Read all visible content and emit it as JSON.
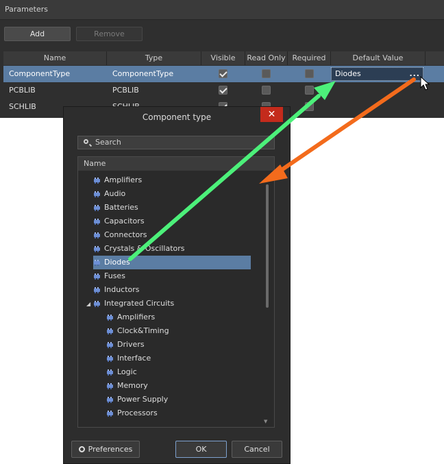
{
  "panel": {
    "title": "Parameters",
    "add_label": "Add",
    "remove_label": "Remove",
    "columns": [
      "Name",
      "Type",
      "Visible",
      "Read Only",
      "Required",
      "Default Value"
    ],
    "rows": [
      {
        "name": "ComponentType",
        "type": "ComponentType",
        "visible": true,
        "read_only": false,
        "required": false,
        "default_value": "Diodes",
        "selected": true
      },
      {
        "name": "PCBLIB",
        "type": "PCBLIB",
        "visible": true,
        "read_only": false,
        "required": false,
        "default_value": "",
        "selected": false
      },
      {
        "name": "SCHLIB",
        "type": "SCHLIB",
        "visible": true,
        "read_only": false,
        "required": false,
        "default_value": "",
        "selected": false
      }
    ],
    "browse_label": "..."
  },
  "dialog": {
    "title": "Component type",
    "close_glyph": "✕",
    "search_placeholder": "Search",
    "tree_header": "Name",
    "items": [
      {
        "label": "Amplifiers",
        "level": 0
      },
      {
        "label": "Audio",
        "level": 0
      },
      {
        "label": "Batteries",
        "level": 0
      },
      {
        "label": "Capacitors",
        "level": 0
      },
      {
        "label": "Connectors",
        "level": 0
      },
      {
        "label": "Crystals & Oscillators",
        "level": 0
      },
      {
        "label": "Diodes",
        "level": 0,
        "selected": true
      },
      {
        "label": "Fuses",
        "level": 0
      },
      {
        "label": "Inductors",
        "level": 0
      },
      {
        "label": "Integrated Circuits",
        "level": 0,
        "expanded": true
      },
      {
        "label": "Amplifiers",
        "level": 1
      },
      {
        "label": "Clock&Timing",
        "level": 1
      },
      {
        "label": "Drivers",
        "level": 1
      },
      {
        "label": "Interface",
        "level": 1
      },
      {
        "label": "Logic",
        "level": 1
      },
      {
        "label": "Memory",
        "level": 1
      },
      {
        "label": "Power Supply",
        "level": 1
      },
      {
        "label": "Processors",
        "level": 1
      }
    ],
    "preferences_label": "Preferences",
    "ok_label": "OK",
    "cancel_label": "Cancel"
  },
  "colors": {
    "selection": "#5b7da3",
    "green_arrow": "#4cf07a",
    "orange_arrow": "#f36b1c"
  },
  "icons": {
    "search": "magnifier-icon",
    "gear": "gear-icon",
    "component": "component-icon",
    "close": "close-icon"
  }
}
